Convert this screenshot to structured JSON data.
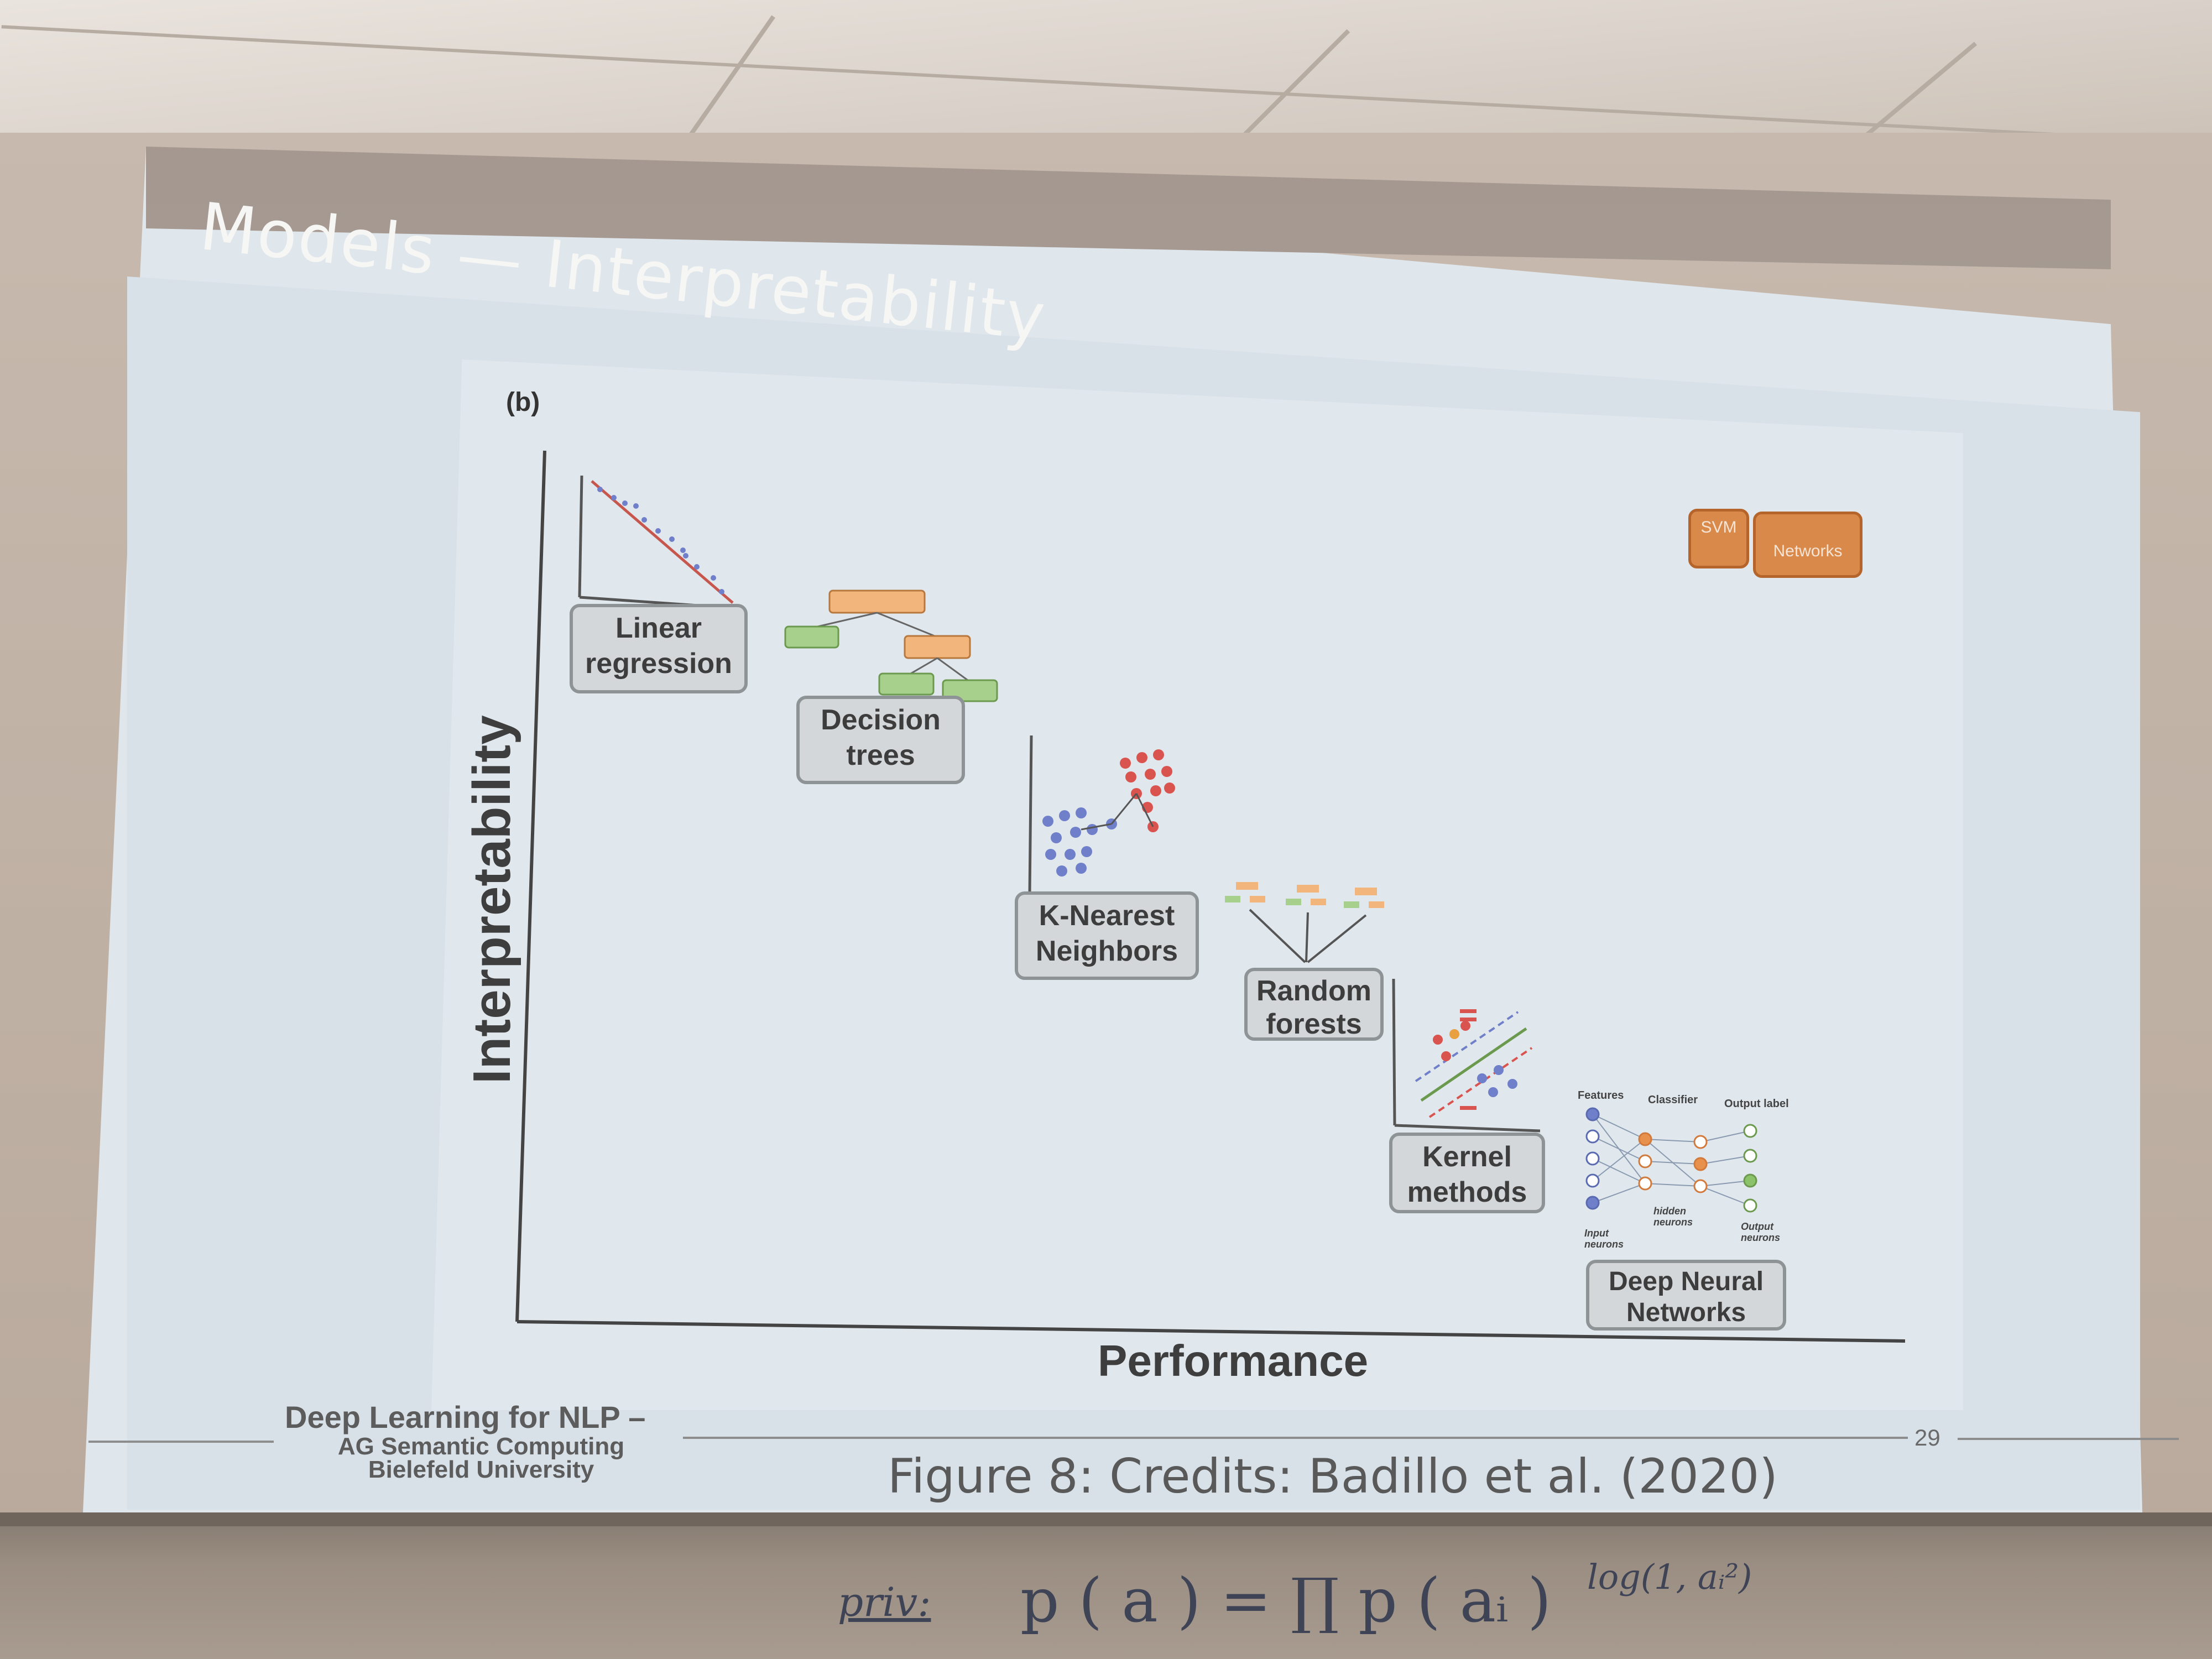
{
  "slide": {
    "title": "Models — Interpretability",
    "panel_label": "(b)",
    "y_axis": "Interpretability",
    "x_axis": "Performance",
    "models": {
      "linear": [
        "Linear",
        "regression"
      ],
      "decision": [
        "Decision",
        "trees"
      ],
      "knn": [
        "K-Nearest",
        "Neighbors"
      ],
      "rf": [
        "Random",
        "forests"
      ],
      "kernel": [
        "Kernel",
        "methods"
      ],
      "dnn": [
        "Deep Neural",
        "Networks"
      ]
    },
    "partial_boxes": {
      "svm": "SVM",
      "networks": "Networks"
    },
    "dnn_diagram": {
      "features": "Features",
      "classifier": "Classifier",
      "output_label": "Output label",
      "input_neurons": "Input neurons",
      "hidden_neurons": "hidden neurons",
      "output_neurons": "Output neurons"
    },
    "footer": {
      "course": "Deep Learning for NLP –",
      "group": "AG Semantic Computing",
      "university": "Bielefeld University",
      "page": "29"
    },
    "caption": "Figure 8: Credits: Badillo et al. (2020)"
  },
  "whiteboard": {
    "word": "priv:",
    "formula": "p ( a ) = ∏ p ( aᵢ )",
    "side_note": "log(1, aᵢ²)"
  },
  "colors": {
    "label_fill": "#d3d7da",
    "label_border": "#8e9396",
    "orange_box": "#d98a4a",
    "tree_node_orange": "#f2b57c",
    "tree_node_green": "#a8d08d",
    "red_points": "#d9534f",
    "blue_points": "#6f7fc9"
  },
  "icons": [
    "scatter-plot-icon",
    "decision-tree-icon",
    "knn-cluster-icon",
    "random-forest-icon",
    "svm-margin-icon",
    "neural-network-icon"
  ]
}
